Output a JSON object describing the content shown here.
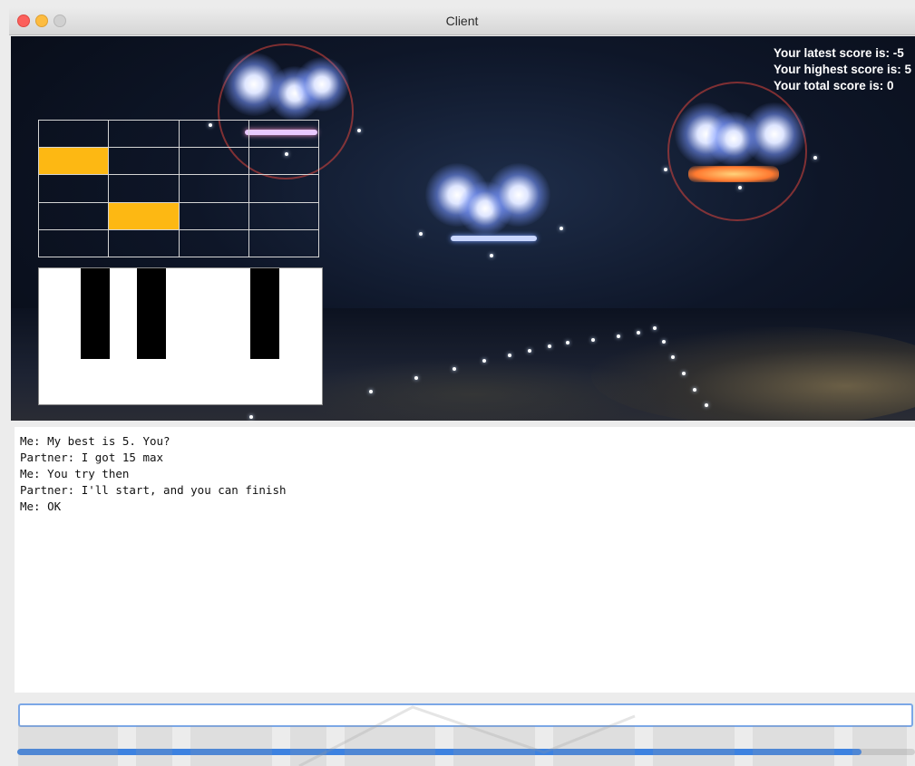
{
  "window": {
    "title": "Client"
  },
  "scores": {
    "latest": "Your latest score is: -5",
    "highest": "Your highest score is: 5",
    "total": "Your total score is: 0"
  },
  "grid": {
    "rows": 5,
    "cols": 4,
    "cells": [
      [
        false,
        false,
        false,
        false
      ],
      [
        true,
        false,
        false,
        false
      ],
      [
        false,
        false,
        false,
        false
      ],
      [
        false,
        true,
        false,
        false
      ],
      [
        false,
        false,
        false,
        false
      ]
    ],
    "highlight_color": "#fdb813"
  },
  "piano": {
    "white_keys": 5,
    "black_keys": 3
  },
  "chat": {
    "messages": [
      "Me: My best is 5. You?",
      "Partner: I got 15 max",
      "Me: You try then",
      "Partner: I'll start, and you can finish",
      "Me: OK"
    ]
  },
  "input": {
    "value": ""
  },
  "progress": {
    "fraction": 0.94
  },
  "colors": {
    "accent": "#3d82e0",
    "input_border": "#7ba7e6"
  }
}
